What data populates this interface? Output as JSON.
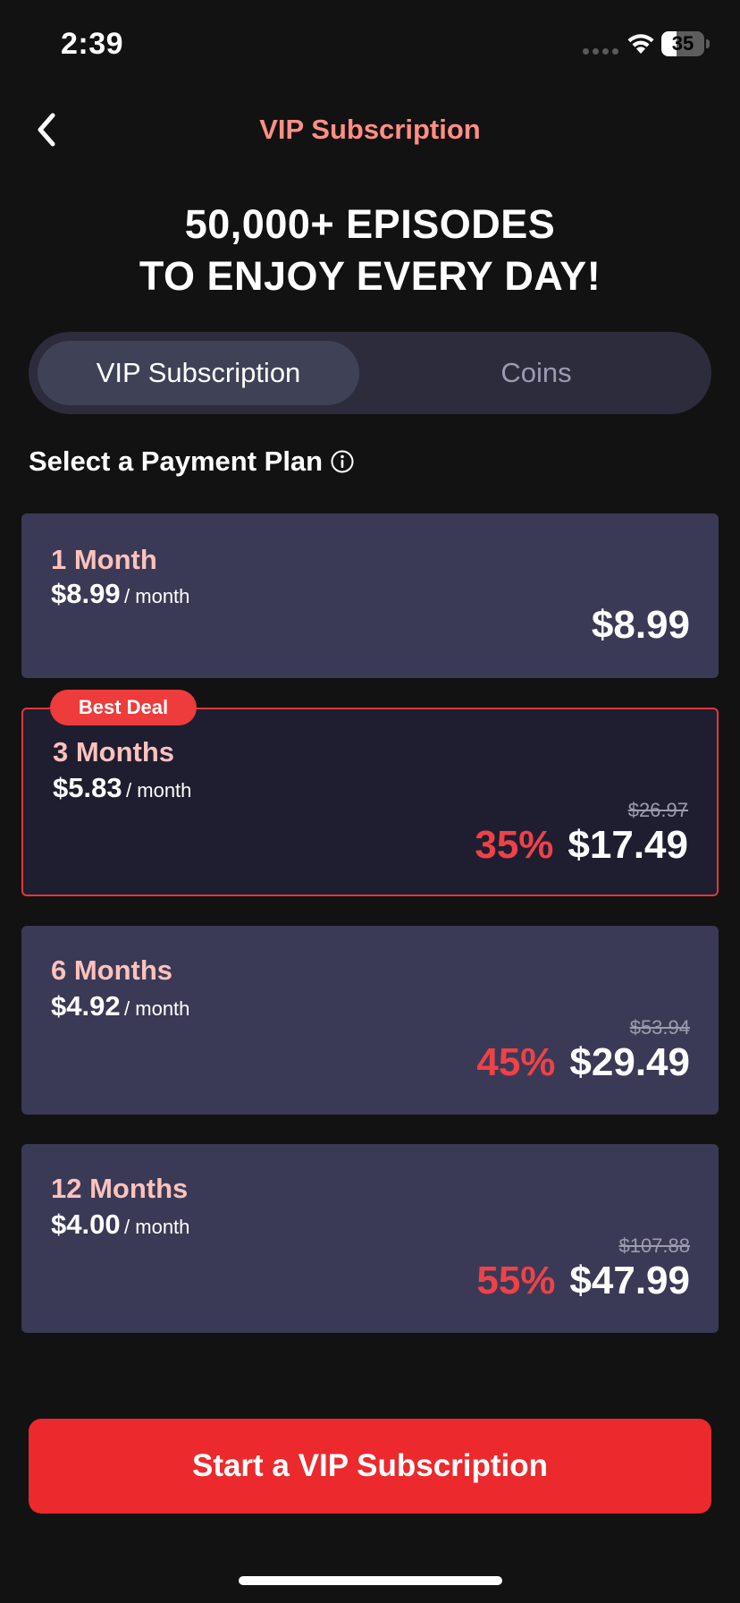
{
  "status_bar": {
    "time": "2:39",
    "battery_level": "35",
    "battery_fraction": 0.35
  },
  "nav": {
    "title": "VIP Subscription",
    "back_icon": "chevron-left-icon"
  },
  "headline": {
    "line1": "50,000+ EPISODES",
    "line2": "TO ENJOY EVERY DAY!"
  },
  "tabs": [
    {
      "label": "VIP Subscription",
      "active": true
    },
    {
      "label": "Coins",
      "active": false
    }
  ],
  "section": {
    "title": "Select a Payment Plan",
    "info_icon": "info-icon"
  },
  "plans": [
    {
      "name": "1 Month",
      "monthly_price": "$8.99",
      "monthly_unit": "/ month",
      "original_price": "",
      "discount": "",
      "total": "$8.99",
      "badge": ""
    },
    {
      "name": "3 Months",
      "monthly_price": "$5.83",
      "monthly_unit": "/ month",
      "original_price": "$26.97",
      "discount": "35%",
      "total": "$17.49",
      "badge": "Best Deal"
    },
    {
      "name": "6 Months",
      "monthly_price": "$4.92",
      "monthly_unit": "/ month",
      "original_price": "$53.94",
      "discount": "45%",
      "total": "$29.49",
      "badge": ""
    },
    {
      "name": "12 Months",
      "monthly_price": "$4.00",
      "monthly_unit": "/ month",
      "original_price": "$107.88",
      "discount": "55%",
      "total": "$47.99",
      "badge": ""
    }
  ],
  "selected_plan": "3 Months",
  "cta": {
    "label": "Start a VIP Subscription"
  },
  "colors": {
    "background": "#121212",
    "accent_red": "#ec292c",
    "nav_title": "#ff8f86",
    "plan_name": "#ffc2bd",
    "plan_card": "#3a3a56",
    "selected_card": "#1e1e30",
    "discount": "#ee4248"
  }
}
